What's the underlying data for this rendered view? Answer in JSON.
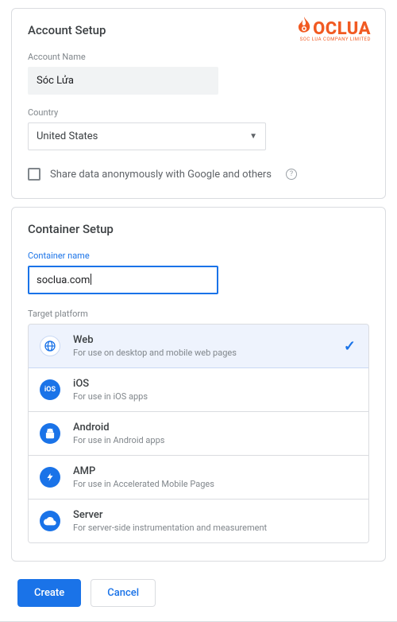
{
  "brand": {
    "name_prefix": "S",
    "name": "OCLUA",
    "subtitle": "SOC LUA COMPANY LIMITED"
  },
  "account": {
    "title": "Account Setup",
    "name_label": "Account Name",
    "name_value": "Sóc Lửa",
    "country_label": "Country",
    "country_value": "United States",
    "share_label": "Share data anonymously with Google and others"
  },
  "container": {
    "title": "Container Setup",
    "name_label": "Container name",
    "name_value": "soclua.com",
    "target_label": "Target platform",
    "platforms": [
      {
        "id": "web",
        "title": "Web",
        "desc": "For use on desktop and mobile web pages",
        "icon": "globe",
        "selected": true
      },
      {
        "id": "ios",
        "title": "iOS",
        "desc": "For use in iOS apps",
        "icon": "ios",
        "selected": false
      },
      {
        "id": "android",
        "title": "Android",
        "desc": "For use in Android apps",
        "icon": "android",
        "selected": false
      },
      {
        "id": "amp",
        "title": "AMP",
        "desc": "For use in Accelerated Mobile Pages",
        "icon": "bolt",
        "selected": false
      },
      {
        "id": "server",
        "title": "Server",
        "desc": "For server-side instrumentation and measurement",
        "icon": "cloud",
        "selected": false
      }
    ]
  },
  "buttons": {
    "create": "Create",
    "cancel": "Cancel"
  },
  "colors": {
    "primary": "#1a73e8",
    "brand": "#f15a22"
  }
}
